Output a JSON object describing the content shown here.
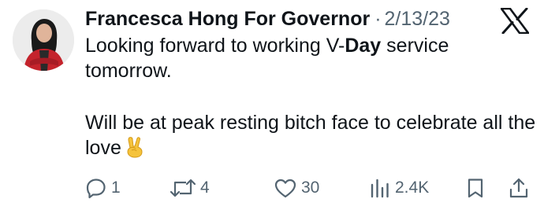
{
  "tweet": {
    "author": {
      "name": "Francesca Hong For Governor",
      "avatar_icon": "profile-photo"
    },
    "separator": "·",
    "date": "2/13/23",
    "platform_icon": "x-logo-icon",
    "text": {
      "line1_before": "Looking forward to working V-",
      "line1_bold": "Day",
      "line1_after": " service tomorrow.",
      "paragraph2": "Will be at peak resting bitch face to celebrate all the love",
      "emoji_icon": "victory-hand-emoji"
    },
    "actions": {
      "replies": "1",
      "reposts": "4",
      "likes": "30",
      "views": "2.4K"
    }
  },
  "colors": {
    "text": "#0f1419",
    "secondary": "#536471",
    "background": "#ffffff"
  }
}
